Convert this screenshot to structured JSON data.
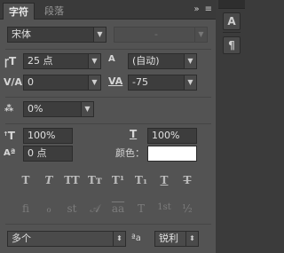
{
  "tabs": [
    {
      "label": "字符",
      "active": true
    },
    {
      "label": "段落",
      "active": false
    }
  ],
  "tab_icons": {
    "collapse": "»",
    "menu": "≡"
  },
  "font": {
    "family": "宋体",
    "style": "-"
  },
  "size": {
    "value": "25 点"
  },
  "leading": {
    "value": "(自动)"
  },
  "kerning": {
    "value": "0"
  },
  "tracking": {
    "value": "-75"
  },
  "tsume": {
    "value": "0%"
  },
  "vertical_scale": {
    "value": "100%"
  },
  "horizontal_scale": {
    "value": "100%"
  },
  "baseline_shift": {
    "value": "0 点"
  },
  "color": {
    "label": "颜色：",
    "value": "#ffffff"
  },
  "style_buttons": [
    "T",
    "T",
    "TT",
    "Tт",
    "T¹",
    "T₁",
    "T",
    "T"
  ],
  "opentype_buttons": [
    "fi",
    "ℴ",
    "st",
    "𝒜",
    "aa",
    "T",
    "1st",
    "½"
  ],
  "language": {
    "value": "多个"
  },
  "antialias": {
    "label": "ªa",
    "value": "锐利"
  },
  "side_buttons": {
    "character": "A",
    "paragraph": "¶"
  }
}
